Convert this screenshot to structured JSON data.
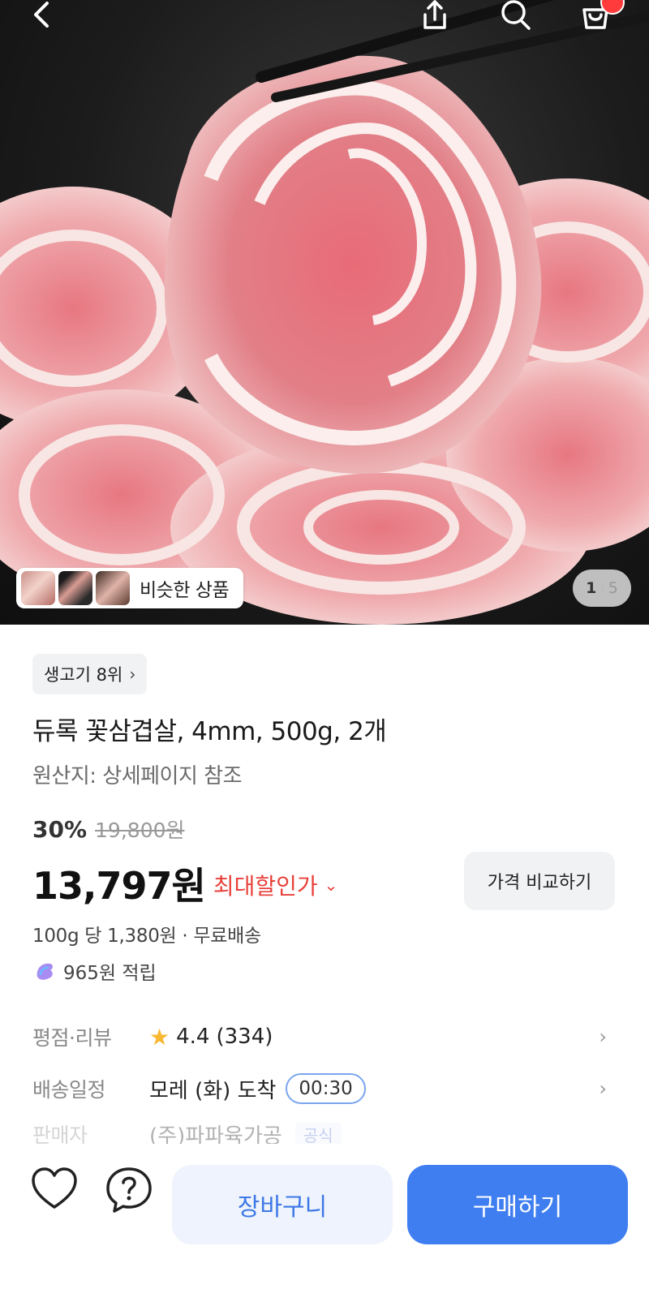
{
  "header": {
    "icons": [
      "back-icon",
      "share-icon",
      "search-icon",
      "cart-icon"
    ],
    "badge_color": "#ff3b3b"
  },
  "gallery": {
    "similar_label": "비슷한 상품",
    "current_page": "1",
    "separator": "|",
    "total_pages": "5"
  },
  "product": {
    "rank_label": "생고기 8위",
    "title": "듀록 꽃삼겹살, 4mm, 500g, 2개",
    "origin": "원산지: 상세페이지 참조",
    "discount_rate": "30%",
    "original_price": "19,800원",
    "price": "13,797원",
    "max_discount_label": "최대할인가",
    "compare_label": "가격 비교하기",
    "unit_price_shipping": "100g 당 1,380원 · 무료배송",
    "points": "965원 적립"
  },
  "info_rows": {
    "review_label": "평점·리뷰",
    "review_rating": "4.4",
    "review_count": "(334)",
    "delivery_label": "배송일정",
    "delivery_value": "모레 (화) 도착",
    "delivery_timer": "00:30",
    "seller_label": "판매자",
    "seller_value": "(주)파파육가공",
    "seller_badge": "공식"
  },
  "bottom_bar": {
    "cart_label": "장바구니",
    "buy_label": "구매하기",
    "accent_color": "#3f7ef0"
  }
}
